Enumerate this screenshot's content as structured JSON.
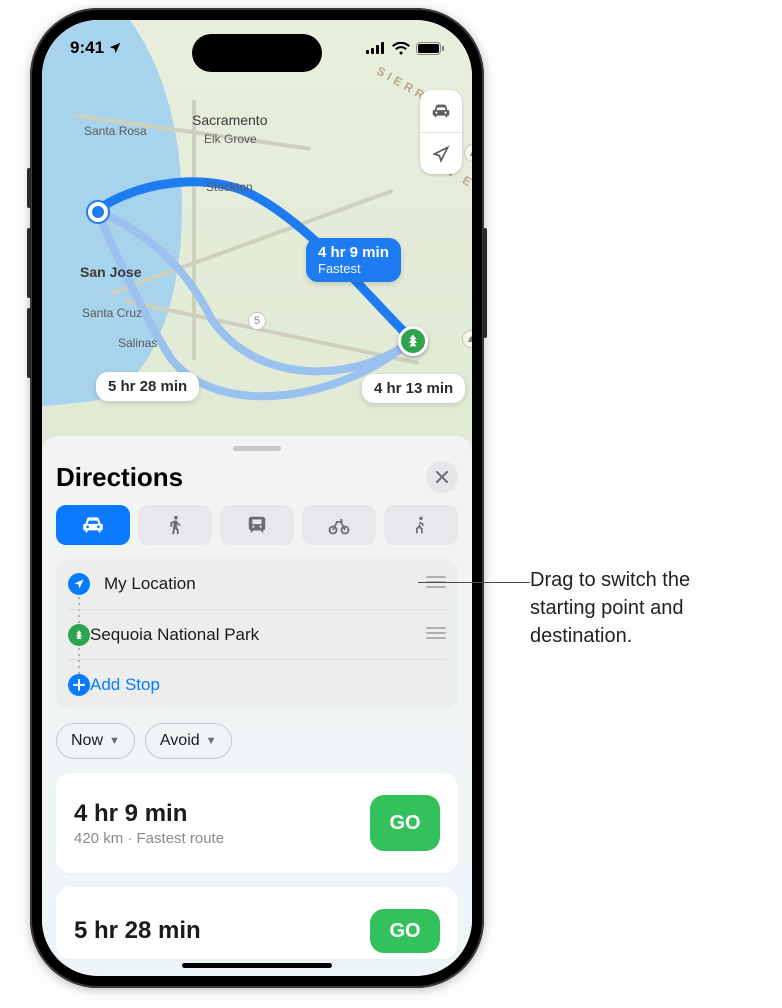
{
  "status": {
    "time": "9:41"
  },
  "map": {
    "labels": {
      "sacramento": "Sacramento",
      "santa_rosa": "Santa Rosa",
      "elk_grove": "Elk Grove",
      "stockton": "Stockton",
      "san_jose": "San Jose",
      "santa_cruz": "Santa Cruz",
      "salinas": "Salinas",
      "sierra": "SIERRA",
      "nevada_line": "N E"
    },
    "bubbles": {
      "fastest_time": "4 hr 9 min",
      "fastest_sub": "Fastest",
      "alt1": "4 hr 13 min",
      "alt2": "5 hr 28 min"
    },
    "highway_5": "5"
  },
  "sheet": {
    "title": "Directions",
    "stops": {
      "origin": "My Location",
      "destination": "Sequoia National Park",
      "add": "Add Stop"
    },
    "pills": {
      "now": "Now",
      "avoid": "Avoid"
    },
    "routes": [
      {
        "time": "4 hr 9 min",
        "sub": "420 km · Fastest route",
        "go": "GO"
      },
      {
        "time": "5 hr 28 min",
        "go": "GO"
      }
    ]
  },
  "callout": {
    "text": "Drag to switch the starting point and destination."
  }
}
